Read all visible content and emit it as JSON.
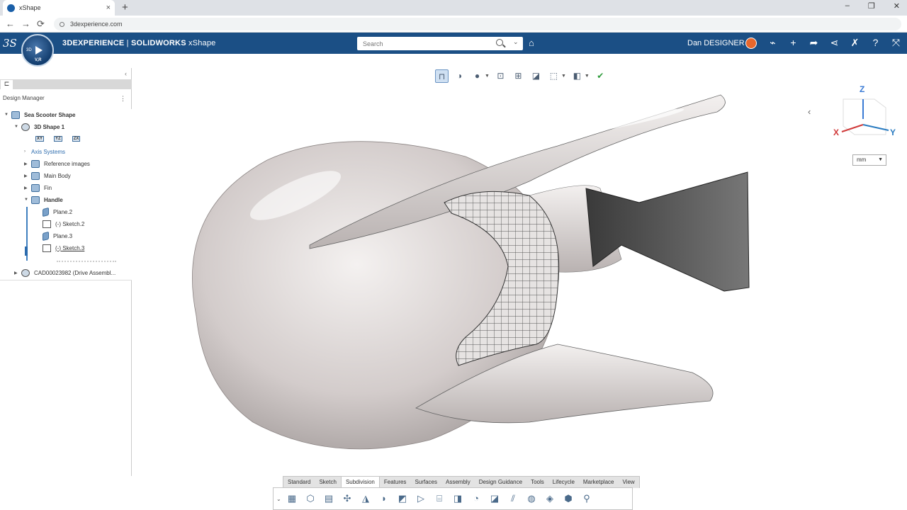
{
  "browser": {
    "tab_title": "xShape",
    "tab_close": "×",
    "new_tab": "+",
    "url": "3dexperience.com",
    "win_min": "–",
    "win_restore": "❐",
    "win_close": "✕"
  },
  "header": {
    "brand_bold": "3DEXPERIENCE",
    "brand_rest": " | ",
    "brand_product": "SOLIDWORKS",
    "brand_app": " xShape",
    "search_placeholder": "Search",
    "user_name": "Dan DESIGNER",
    "compass_3d": "3D",
    "compass_vr": "V,R"
  },
  "left_panel": {
    "title": "Design Manager",
    "tree": [
      {
        "label": "Sea Scooter Shape"
      },
      {
        "label": "3D Shape 1"
      },
      {
        "label": "Axis Systems"
      },
      {
        "label": "Reference images"
      },
      {
        "label": "Main Body"
      },
      {
        "label": "Fin"
      },
      {
        "label": "Handle"
      },
      {
        "label": "Plane.2"
      },
      {
        "label": "(-)   Sketch.2"
      },
      {
        "label": "Plane.3"
      },
      {
        "label": "(-)   Sketch.3"
      },
      {
        "label": "CAD00023982 (Drive Assembl..."
      }
    ],
    "planes": [
      "XY",
      "YZ",
      "ZX"
    ]
  },
  "viewport": {
    "unit": "mm",
    "axis_labels": {
      "z": "Z",
      "x": "X",
      "y": "Y"
    }
  },
  "command_tabs": [
    "Standard",
    "Sketch",
    "Subdivision",
    "Features",
    "Surfaces",
    "Assembly",
    "Design Guidance",
    "Tools",
    "Lifecycle",
    "Marketplace",
    "View"
  ],
  "active_tab": "Subdivision",
  "icons": {
    "back": "←",
    "forward": "→",
    "reload": "⟳",
    "tag": "tag-icon",
    "header_icons": [
      "share-icon",
      "plus-icon",
      "forward-icon",
      "network-icon",
      "tools-icon",
      "help-icon",
      "fullscreen-icon"
    ]
  },
  "colors": {
    "header_bg": "#1b4f85",
    "accent": "#2b6bad",
    "avatar": "#e8672d"
  }
}
